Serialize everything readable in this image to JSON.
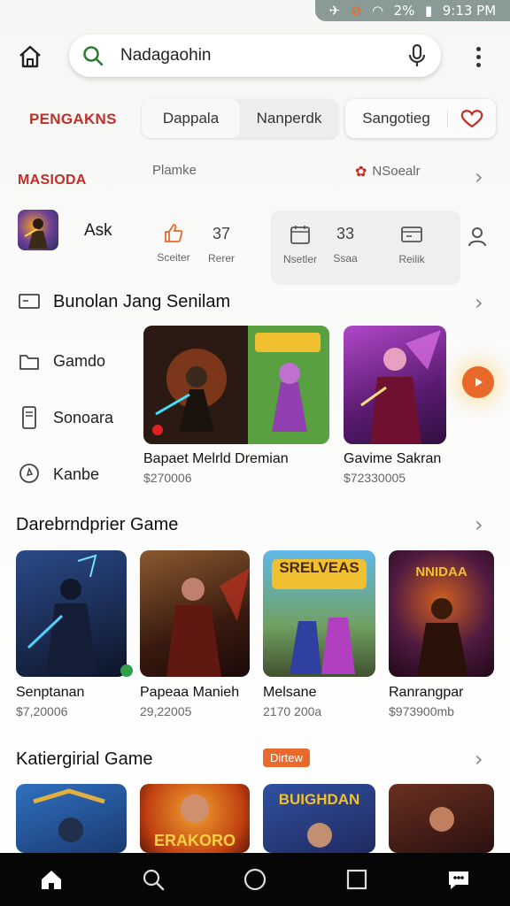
{
  "status_bar": {
    "icons": [
      "signal-icon",
      "no-disturb-icon",
      "wifi-icon",
      "battery-icon"
    ],
    "battery": "2%",
    "time": "9:13 PM"
  },
  "search": {
    "value": "Nadagaohin"
  },
  "brand": {
    "title": "PENGAKNS",
    "color": "#c0302a"
  },
  "tabs": [
    {
      "label": "Dappala",
      "active": true
    },
    {
      "label": "Nanperdk",
      "active": false
    }
  ],
  "tab_single": {
    "label": "Sangotieg"
  },
  "sub_header": {
    "left": "MASIODA",
    "mid": "Plamke",
    "right": "NSoealr"
  },
  "app_row": {
    "name": "Ask",
    "stats": [
      {
        "icon": "thumbs-up-icon",
        "num": "",
        "label": "Sceiter"
      },
      {
        "icon": "",
        "num": "37",
        "label": "Rerer"
      },
      {
        "icon": "calendar-icon",
        "num": "",
        "label": "Nsetler"
      },
      {
        "icon": "",
        "num": "33",
        "label": "Ssaa"
      },
      {
        "icon": "card-icon",
        "num": "",
        "label": "Reilik"
      }
    ]
  },
  "section1": {
    "title": "Bunolan Jang Senilam",
    "side_items": [
      {
        "icon": "monitor-icon",
        "label": ""
      },
      {
        "icon": "folder-icon",
        "label": "Gamdo"
      },
      {
        "icon": "phone-icon",
        "label": "Sonoara"
      },
      {
        "icon": "location-icon",
        "label": "Kanbe"
      }
    ],
    "cards": [
      {
        "title": "Bapaet Melrld Dremian",
        "sub": "$270006"
      },
      {
        "title": "Gavime Sakran",
        "sub": "$72330005"
      }
    ]
  },
  "section2": {
    "title": "Darebrndprier Game",
    "cards": [
      {
        "title": "Senptanan",
        "sub": "$7,20006"
      },
      {
        "title": "Papeaa Manieh",
        "sub": "29,22005"
      },
      {
        "title": "Melsane",
        "sub": "2170 200a"
      },
      {
        "title": "Ranrangpar",
        "sub": "$973900mb"
      }
    ],
    "card_labels": [
      "",
      "",
      "SRELVEAS",
      "NNIDAA"
    ]
  },
  "section3": {
    "title": "Katiergirial Game",
    "badge": "Dirtew",
    "card_labels": [
      "",
      "ERAKORO",
      "BUIGHDAN",
      ""
    ]
  },
  "bottom_nav": [
    "home-icon",
    "search-icon",
    "circle-icon",
    "square-icon",
    "chat-icon"
  ],
  "colors": {
    "accent": "#e8692a",
    "brand": "#c0302a"
  }
}
